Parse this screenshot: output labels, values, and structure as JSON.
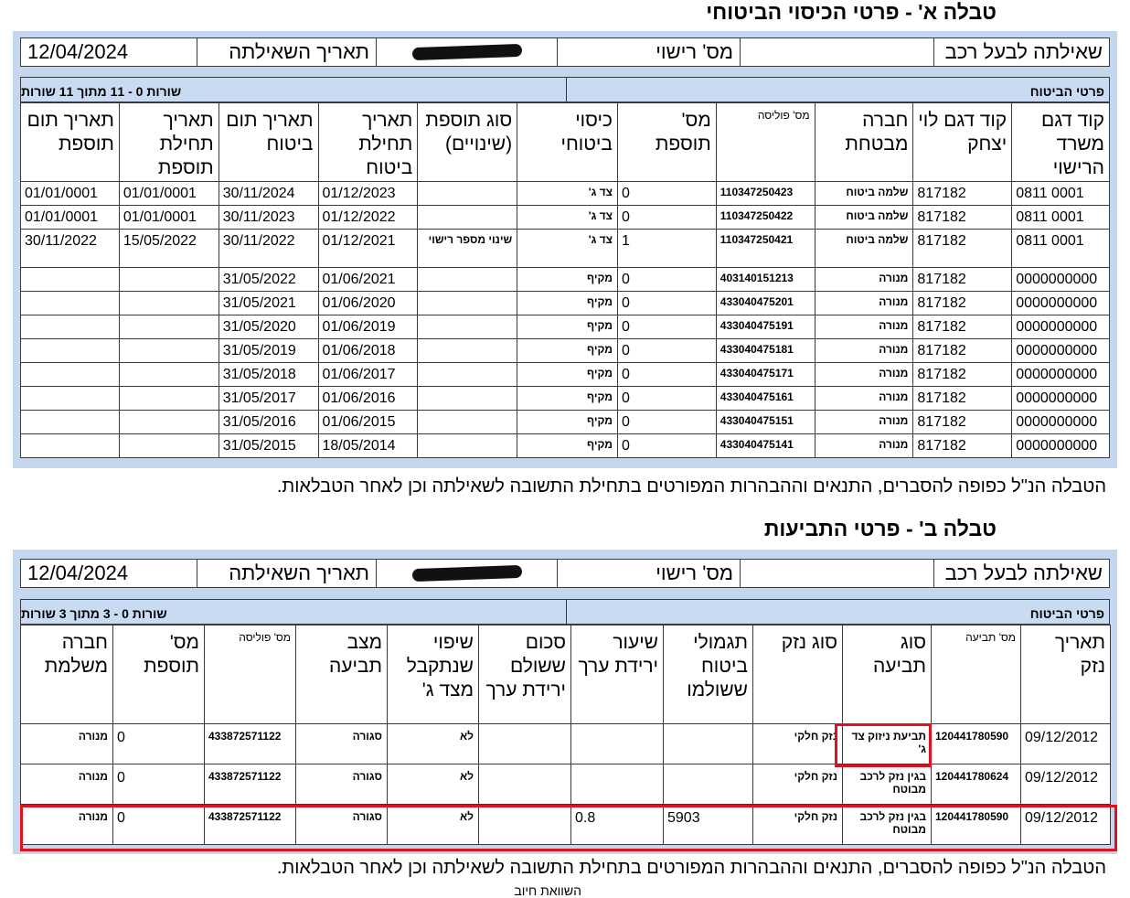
{
  "table_a": {
    "title": "טבלה א' - פרטי הכיסוי הביטוחי",
    "query": {
      "owner_label": "שאילתה לבעל רכב",
      "license_label": "מס' רישוי",
      "date_label": "תאריך השאילתה",
      "date_value": "12/04/2024"
    },
    "section_label": "פרטי הביטוח",
    "rows_summary": "שורות 0 - 11 מתוך 11 שורות",
    "headers": [
      "קוד דגם משרד הרישוי",
      "קוד דגם לוי יצחק",
      "חברה מבטחת",
      "מס' פוליסה",
      "מס' תוספת",
      "כיסוי ביטוחי",
      "סוג תוספת (שינויים)",
      "תאריך תחילת ביטוח",
      "תאריך תום ביטוח",
      "תאריך תחילת תוספת",
      "תאריך תום תוספת"
    ],
    "rows": [
      [
        "0811 0001",
        "817182",
        "שלמה ביטוח",
        "110347250423",
        "0",
        "צד ג'",
        "",
        "01/12/2023",
        "30/11/2024",
        "01/01/0001",
        "01/01/0001"
      ],
      [
        "0811 0001",
        "817182",
        "שלמה ביטוח",
        "110347250422",
        "0",
        "צד ג'",
        "",
        "01/12/2022",
        "30/11/2023",
        "01/01/0001",
        "01/01/0001"
      ],
      [
        "0811 0001",
        "817182",
        "שלמה ביטוח",
        "110347250421",
        "1",
        "צד ג'",
        "שינוי מספר רישוי",
        "01/12/2021",
        "30/11/2022",
        "15/05/2022",
        "30/11/2022"
      ],
      [
        "0000000000",
        "817182",
        "מנורה",
        "403140151213",
        "0",
        "מקיף",
        "",
        "01/06/2021",
        "31/05/2022",
        "",
        ""
      ],
      [
        "0000000000",
        "817182",
        "מנורה",
        "433040475201",
        "0",
        "מקיף",
        "",
        "01/06/2020",
        "31/05/2021",
        "",
        ""
      ],
      [
        "0000000000",
        "817182",
        "מנורה",
        "433040475191",
        "0",
        "מקיף",
        "",
        "01/06/2019",
        "31/05/2020",
        "",
        ""
      ],
      [
        "0000000000",
        "817182",
        "מנורה",
        "433040475181",
        "0",
        "מקיף",
        "",
        "01/06/2018",
        "31/05/2019",
        "",
        ""
      ],
      [
        "0000000000",
        "817182",
        "מנורה",
        "433040475171",
        "0",
        "מקיף",
        "",
        "01/06/2017",
        "31/05/2018",
        "",
        ""
      ],
      [
        "0000000000",
        "817182",
        "מנורה",
        "433040475161",
        "0",
        "מקיף",
        "",
        "01/06/2016",
        "31/05/2017",
        "",
        ""
      ],
      [
        "0000000000",
        "817182",
        "מנורה",
        "433040475151",
        "0",
        "מקיף",
        "",
        "01/06/2015",
        "31/05/2016",
        "",
        ""
      ],
      [
        "0000000000",
        "817182",
        "מנורה",
        "433040475141",
        "0",
        "מקיף",
        "",
        "18/05/2014",
        "31/05/2015",
        "",
        ""
      ]
    ],
    "footnote": "הטבלה הנ\"ל כפופה להסברים, התנאים וההבהרות המפורטים בתחילת התשובה לשאילתה וכן לאחר הטבלאות."
  },
  "table_b": {
    "title": "טבלה ב' - פרטי התביעות",
    "query": {
      "owner_label": "שאילתה לבעל רכב",
      "license_label": "מס' רישוי",
      "date_label": "תאריך השאילתה",
      "date_value": "12/04/2024"
    },
    "section_label": "פרטי הביטוח",
    "rows_summary": "שורות 0 - 3  מתוך 3 שורות",
    "headers": [
      "תאריך נזק",
      "מס' תביעה",
      "סוג תביעה",
      "סוג נזק",
      "תגמולי ביטוח ששולמו",
      "שיעור ירידת ערך",
      "סכום ששולם ירידת ערך",
      "שיפוי שנתקבל מצד ג'",
      "מצב תביעה",
      "מס' פוליסה",
      "מס' תוספת",
      "חברה משלמת"
    ],
    "rows": [
      [
        "09/12/2012",
        "120441780590",
        "תביעת ניזוק צד ג'",
        "נזק חלקי",
        "",
        "",
        "",
        "לא",
        "סגורה",
        "433872571122",
        "0",
        "מנורה"
      ],
      [
        "09/12/2012",
        "120441780624",
        "בגין נזק לרכב מבוטח",
        "נזק חלקי",
        "",
        "",
        "",
        "לא",
        "סגורה",
        "433872571122",
        "0",
        "מנורה"
      ],
      [
        "09/12/2012",
        "120441780590",
        "בגין נזק לרכב מבוטח",
        "נזק חלקי",
        "5903",
        "0.8",
        "",
        "לא",
        "סגורה",
        "433872571122",
        "0",
        "מנורה"
      ]
    ],
    "footnote": "הטבלה הנ\"ל כפופה להסברים, התנאים וההבהרות המפורטים בתחילת התשובה לשאילתה וכן לאחר הטבלאות.",
    "cut_text": "השוואת חיוב"
  }
}
